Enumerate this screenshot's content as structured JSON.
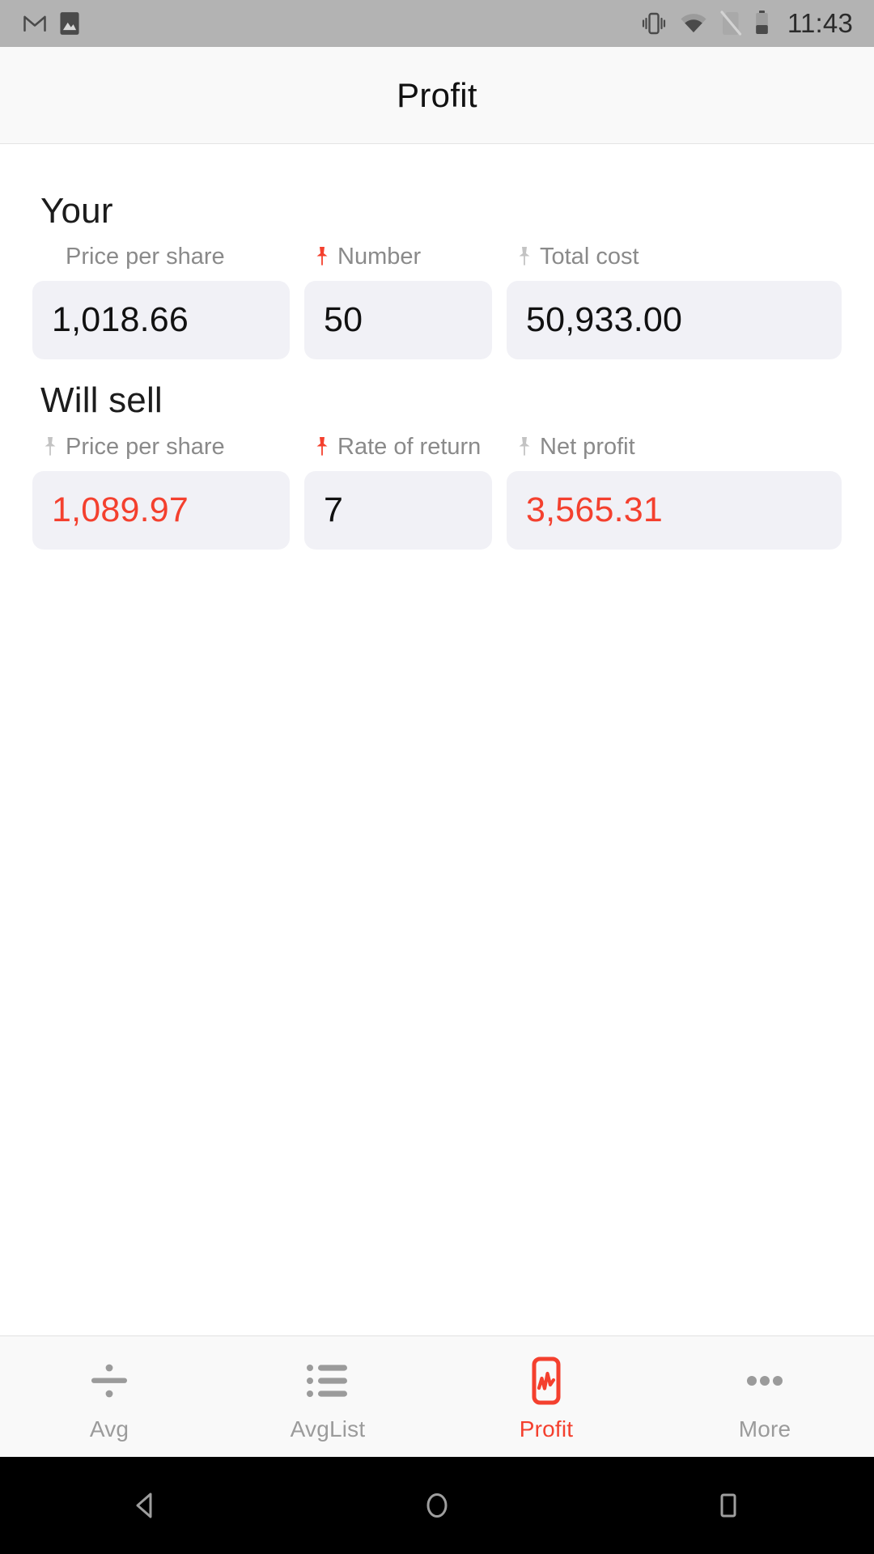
{
  "status_bar": {
    "left_icons": [
      "gmail-icon",
      "gallery-icon"
    ],
    "right_icons": [
      "vibrate-icon",
      "wifi-icon",
      "no-sim-icon",
      "battery-icon"
    ],
    "clock": "11:43"
  },
  "app_bar": {
    "title": "Profit"
  },
  "sections": [
    {
      "title": "Your",
      "fields": [
        {
          "label": "Price per share",
          "value": "1,018.66",
          "pin": "none",
          "value_color": "#111111"
        },
        {
          "label": "Number",
          "value": "50",
          "pin": "red",
          "value_color": "#111111"
        },
        {
          "label": "Total cost",
          "value": "50,933.00",
          "pin": "gray",
          "value_color": "#111111"
        }
      ]
    },
    {
      "title": "Will sell",
      "fields": [
        {
          "label": "Price per share",
          "value": "1,089.97",
          "pin": "gray",
          "value_color": "#f4402e"
        },
        {
          "label": "Rate of return",
          "value": "7",
          "pin": "red",
          "value_color": "#111111"
        },
        {
          "label": "Net profit",
          "value": "3,565.31",
          "pin": "gray",
          "value_color": "#f4402e"
        }
      ]
    }
  ],
  "tab_bar": {
    "tabs": [
      {
        "label": "Avg",
        "icon": "divide-icon",
        "active": false
      },
      {
        "label": "AvgList",
        "icon": "list-icon",
        "active": false
      },
      {
        "label": "Profit",
        "icon": "chart-box-icon",
        "active": true
      },
      {
        "label": "More",
        "icon": "ellipsis-icon",
        "active": false
      }
    ]
  },
  "nav_bar": {
    "buttons": [
      "back-icon",
      "home-icon",
      "recents-icon"
    ]
  },
  "colors": {
    "accent": "#f4402e",
    "field_background": "#f1f1f6",
    "label_gray": "#8a8a8a",
    "status_bar": "#b3b3b3"
  }
}
